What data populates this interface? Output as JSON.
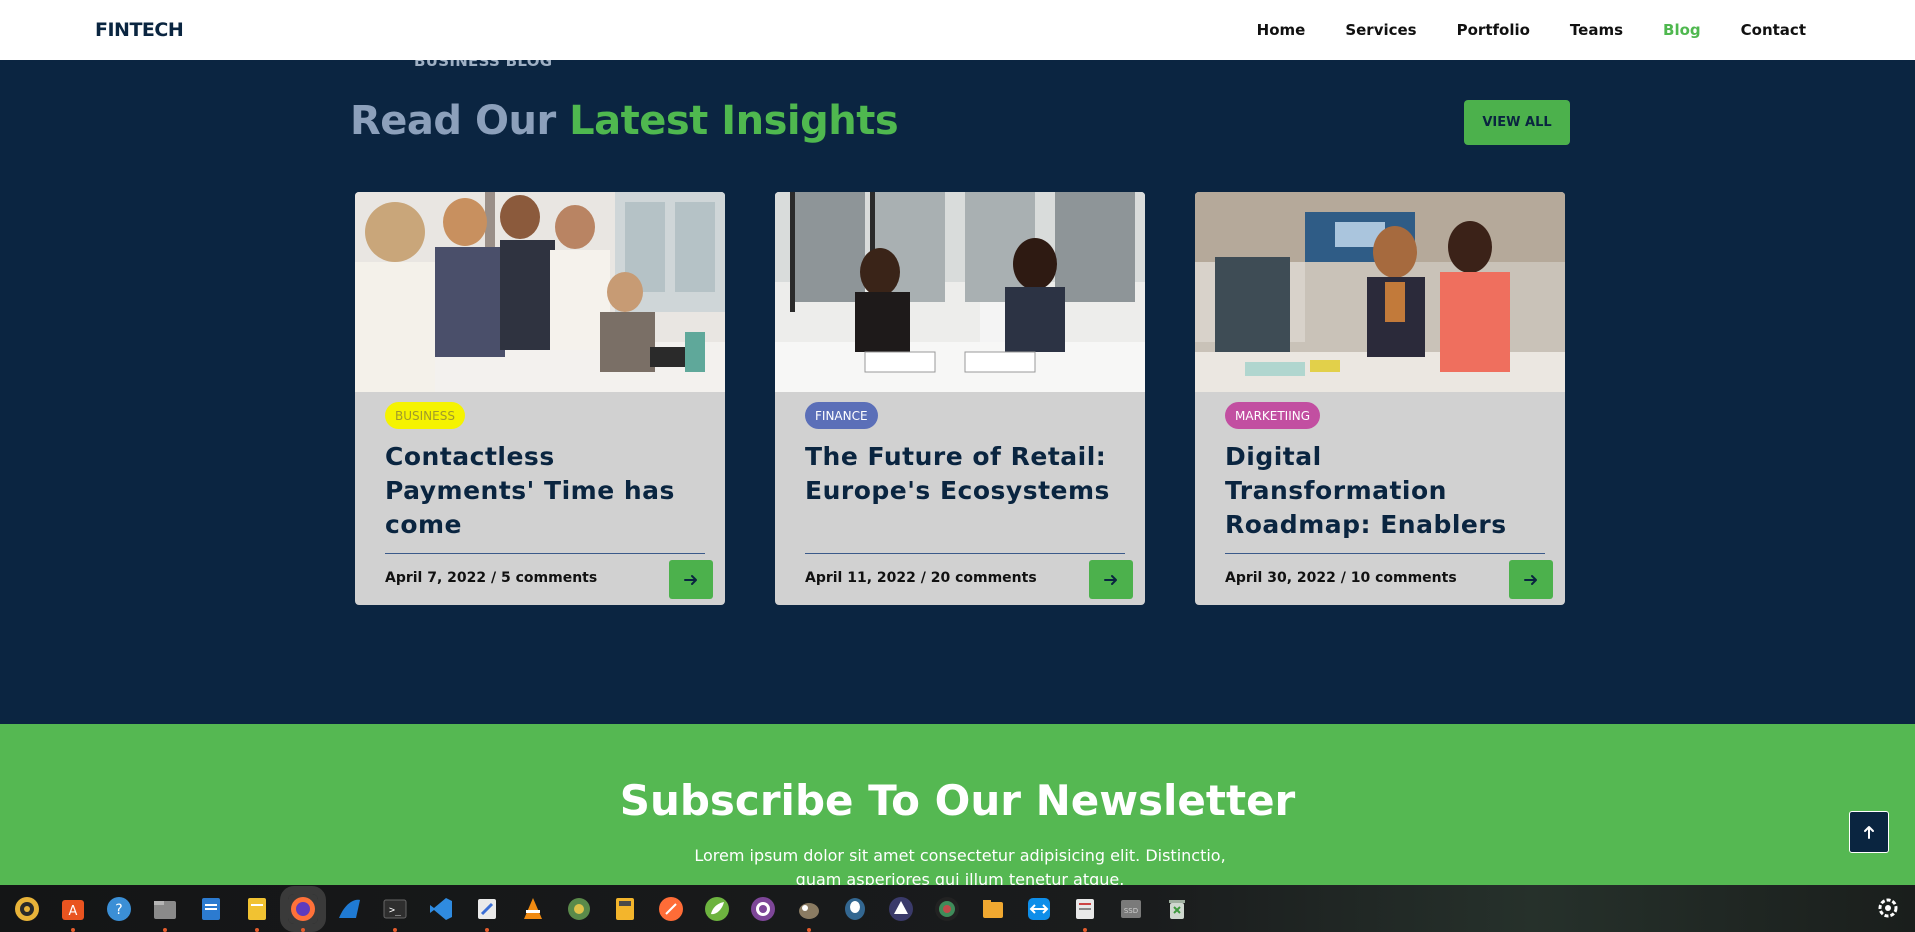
{
  "header": {
    "brand": "FINTECH",
    "nav": [
      "Home",
      "Services",
      "Portfolio",
      "Teams",
      "Blog",
      "Contact"
    ],
    "active_nav": "Blog"
  },
  "blog": {
    "eyebrow": "BUSINESS BLOG",
    "heading_part1": "Read Our ",
    "heading_part2": "Latest Insights",
    "view_all_label": "VIEW ALL",
    "cards": [
      {
        "tag": "BUSINESS",
        "tag_color": "#f5f300",
        "tag_text_color": "#9a9a3a",
        "title": "Contactless Payments' Time has come",
        "meta": "April 7, 2022 / 5 comments"
      },
      {
        "tag": "FINANCE",
        "tag_color": "#5b6fb8",
        "tag_text_color": "#ffffff",
        "title": "The Future of Retail: Europe's Ecosystems",
        "meta": "April 11, 2022 / 20 comments"
      },
      {
        "tag": "MARKETIING",
        "tag_color": "#c24fa1",
        "tag_text_color": "#ffffff",
        "title": "Digital Transformation Roadmap: Enablers",
        "meta": "April 30, 2022 / 10 comments"
      }
    ]
  },
  "newsletter": {
    "title": "Subscribe To Our Newsletter",
    "description": "Lorem ipsum dolor sit amet consectetur adipisicing elit. Distinctio, quam asperiores qui illum tenetur atque."
  },
  "taskbar": {
    "apps": [
      "rhythmbox-icon",
      "app-store-icon",
      "help-icon",
      "files-icon",
      "libreoffice-writer-icon",
      "text-editor-icon",
      "firefox-icon",
      "wireshark-icon",
      "terminal-icon",
      "vscode-icon",
      "gedit-icon",
      "vlc-icon",
      "globe-icon",
      "calculator-icon",
      "postman-icon",
      "spring-icon",
      "tor-icon",
      "gimp-icon",
      "postgres-icon",
      "inkscape-icon",
      "darktable-icon",
      "folder-icon",
      "teamviewer-icon",
      "reader-icon",
      "ssd-icon",
      "trash-icon"
    ],
    "active_app": "firefox-icon"
  },
  "colors": {
    "navy": "#0b2541",
    "green": "#4fb84f",
    "card_bg": "#d1d1d1"
  }
}
